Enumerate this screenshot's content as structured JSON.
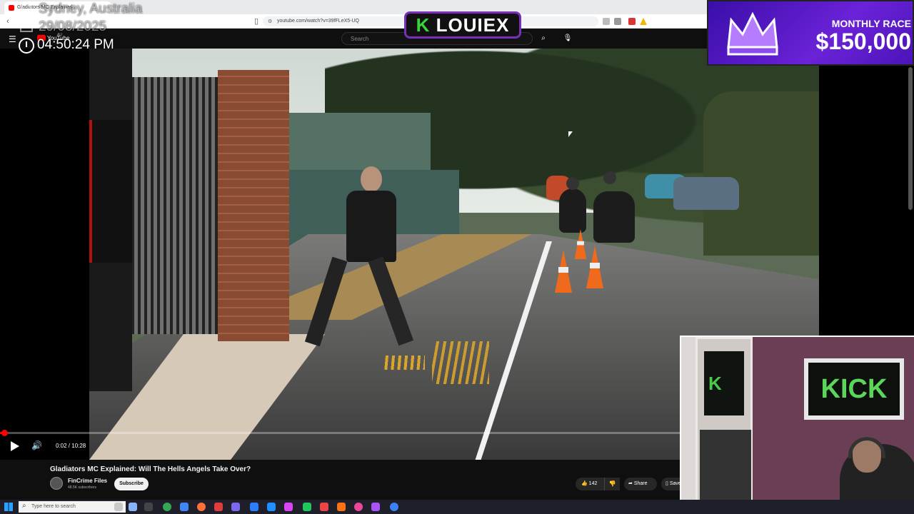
{
  "browser": {
    "tab_title": "Gladiators MC Explained...",
    "url": "youtube.com/watch?v=39fFLeX5-UQ"
  },
  "youtube": {
    "logo": "YouTube",
    "country": "AU",
    "search_placeholder": "Search"
  },
  "player": {
    "current_time": "0:02",
    "duration": "10:28",
    "time_display": "0:02 / 10:28",
    "progress_fraction": 0.003
  },
  "video": {
    "title": "Gladiators MC Explained: Will The Hells Angels Take Over?",
    "channel": "FinCrime Files",
    "subscribers": "48.5K subscribers",
    "subscribe_label": "Subscribe",
    "likes": "142",
    "share_label": "Share",
    "save_label": "Save"
  },
  "overlay": {
    "location": "Sydney, Australia",
    "date": "29/08/2025",
    "time": "04:50:24 PM",
    "streamer": "LOUIEX",
    "race_label": "MONTHLY RACE",
    "race_amount": "$150,000",
    "sign_text": "KICK",
    "door_sign_text": "K"
  },
  "taskbar": {
    "search_placeholder": "Type here to search"
  },
  "colors": {
    "accent_red": "#ff0000",
    "kick_green": "#53fc18",
    "race_purple": "#5a1bd0"
  }
}
